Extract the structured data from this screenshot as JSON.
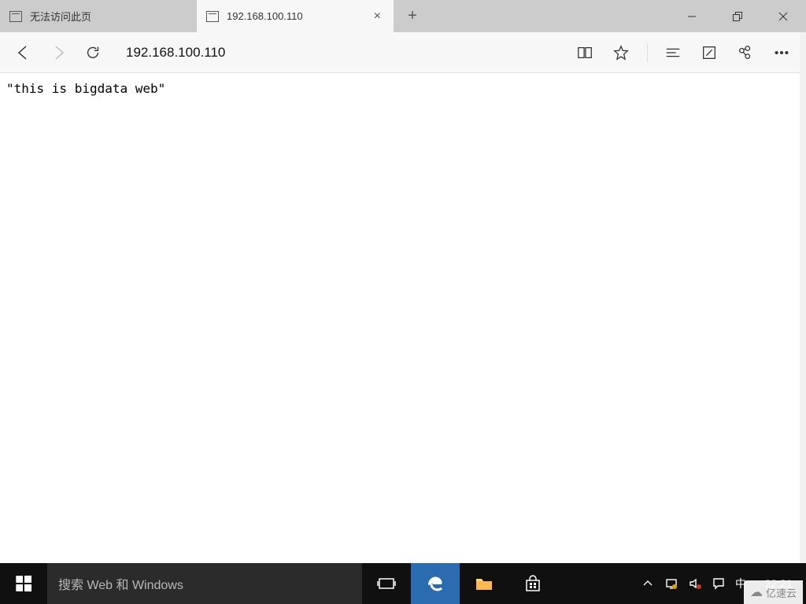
{
  "tabs": [
    {
      "title": "无法访问此页"
    },
    {
      "title": "192.168.100.110"
    }
  ],
  "address_bar": {
    "value": "192.168.100.110"
  },
  "page": {
    "body_text": "\"this is bigdata web\""
  },
  "taskbar": {
    "search_placeholder": "搜索 Web 和 Windows",
    "clock": "22:21",
    "ime": "中"
  },
  "watermark": {
    "text": "亿速云"
  },
  "icons": {
    "back": "back-icon",
    "forward": "forward-icon",
    "refresh": "refresh-icon",
    "reading": "reading-view-icon",
    "star": "favorite-icon",
    "hub": "hub-icon",
    "note": "webnote-icon",
    "share": "share-icon",
    "more": "more-icon",
    "close": "close-icon",
    "newtab": "plus-icon",
    "min": "minimize-icon",
    "max": "restore-icon",
    "cls": "close-window-icon"
  }
}
